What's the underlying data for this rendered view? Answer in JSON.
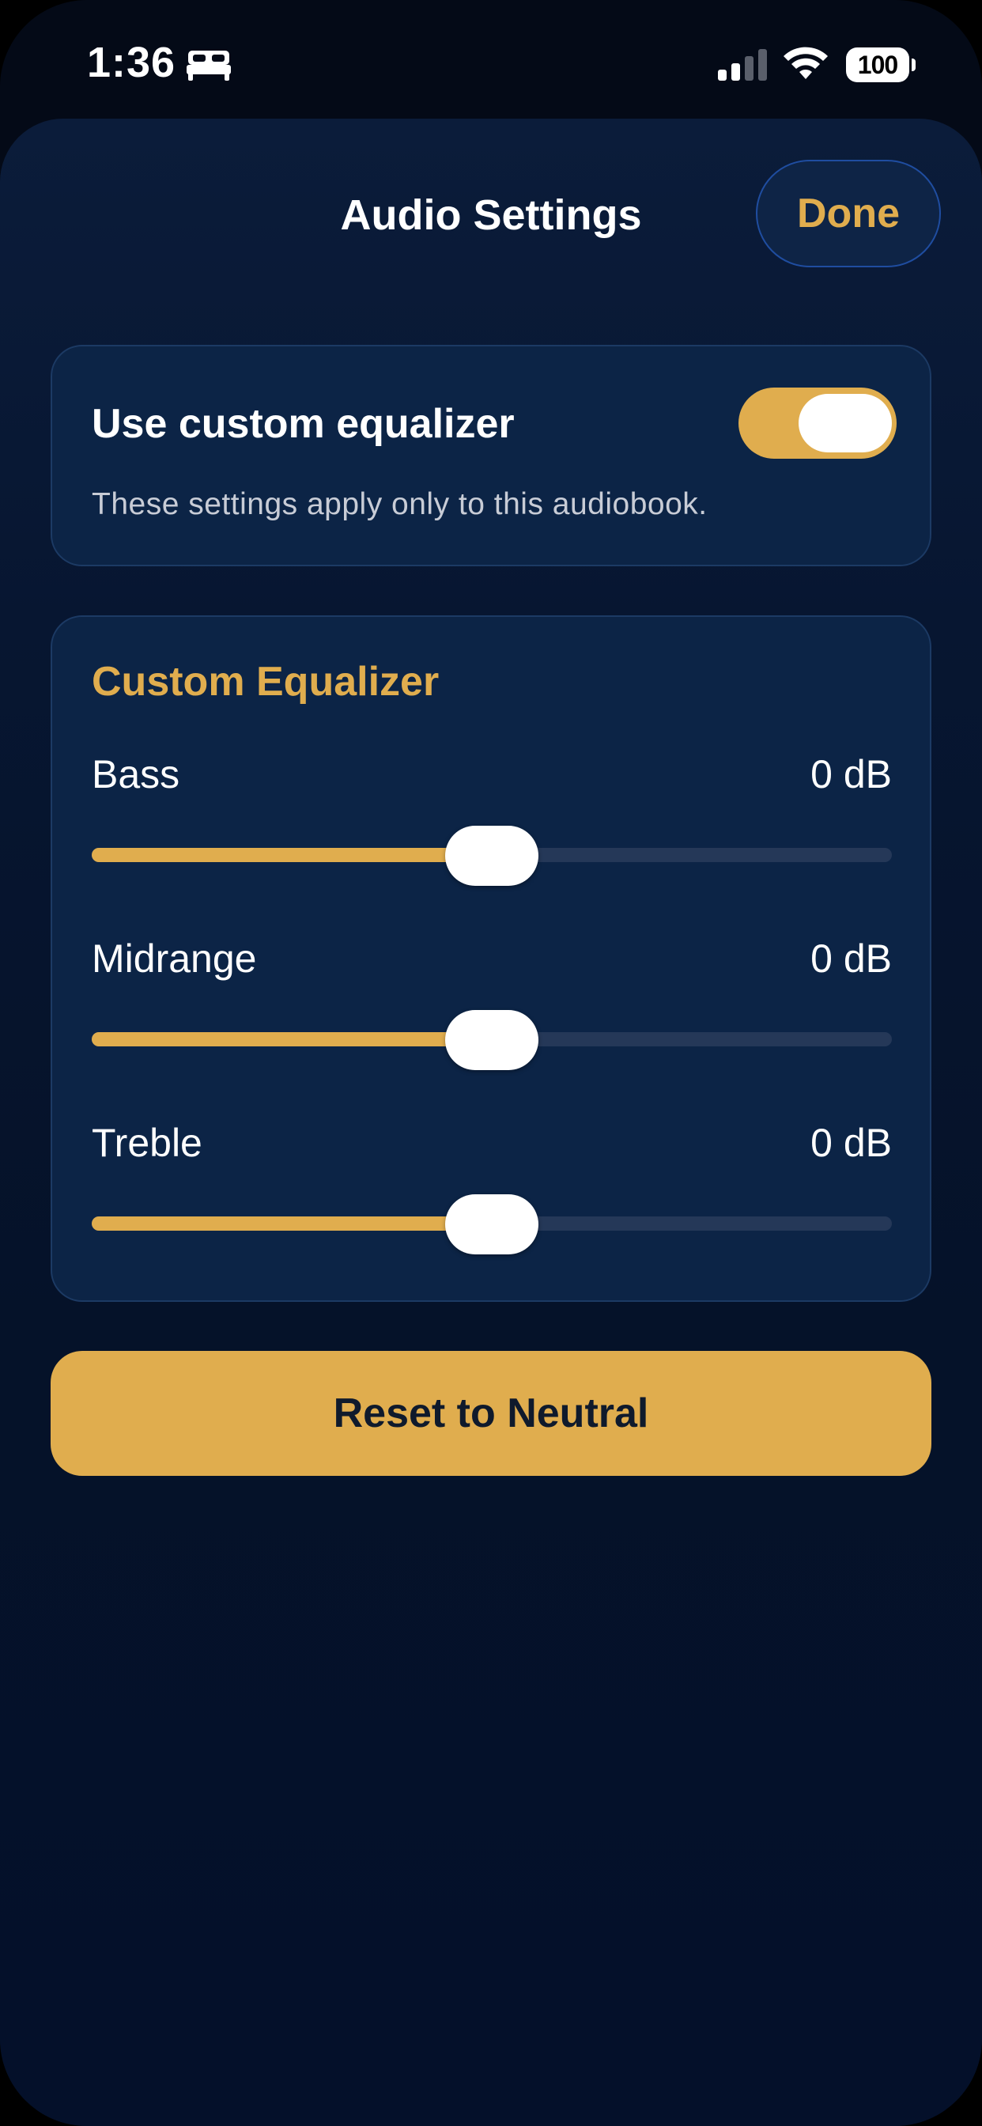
{
  "status_bar": {
    "time": "1:36",
    "battery": "100",
    "icons": [
      "bed-icon",
      "cellular-signal-icon",
      "wifi-icon",
      "battery-icon"
    ]
  },
  "header": {
    "title": "Audio Settings",
    "done_label": "Done"
  },
  "equalizer_toggle": {
    "label": "Use custom equalizer",
    "description": "These settings apply only to this audiobook.",
    "enabled": true
  },
  "custom_equalizer": {
    "title": "Custom Equalizer",
    "bands": [
      {
        "label": "Bass",
        "value": "0 dB",
        "level": 0.5
      },
      {
        "label": "Midrange",
        "value": "0 dB",
        "level": 0.5
      },
      {
        "label": "Treble",
        "value": "0 dB",
        "level": 0.5
      }
    ]
  },
  "reset_label": "Reset to Neutral",
  "colors": {
    "accent": "#e0ad4e",
    "card_background": "#0c2446",
    "background": "#051229",
    "track": "#253858"
  }
}
